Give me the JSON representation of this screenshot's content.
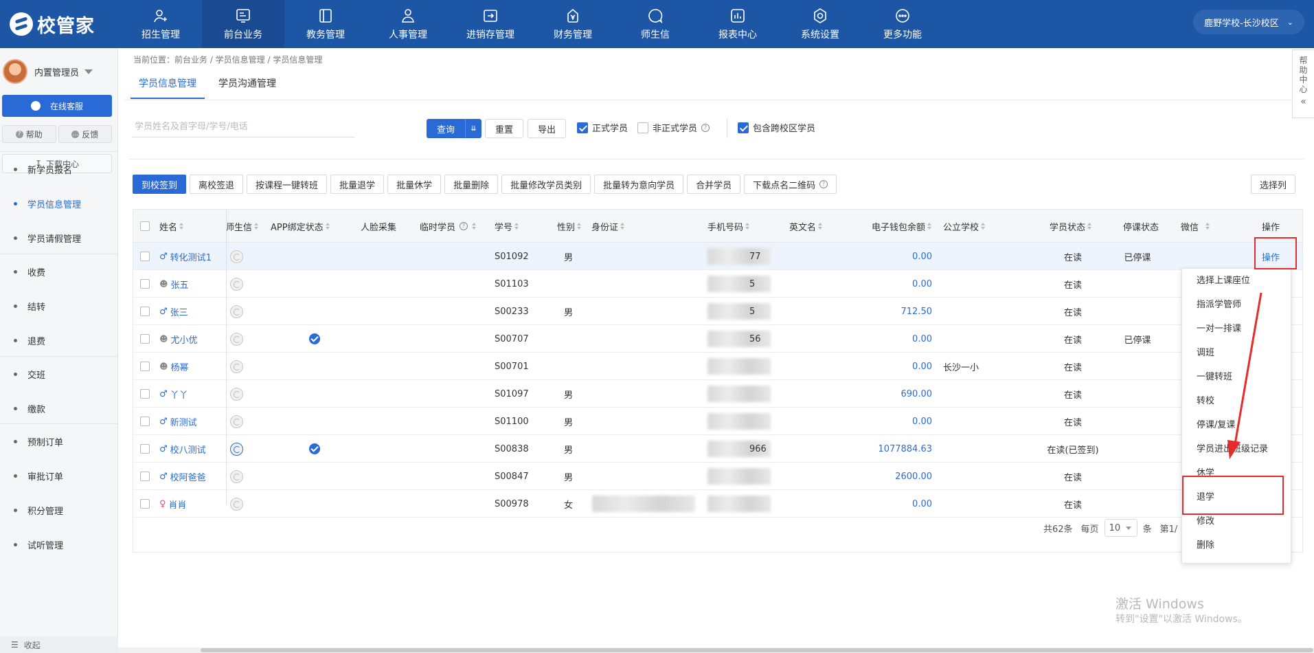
{
  "app": {
    "logo": "校管家",
    "campus": "鹿野学校-长沙校区"
  },
  "nav": [
    {
      "label": "招生管理",
      "icon": "person-plus-icon",
      "active": false
    },
    {
      "label": "前台业务",
      "icon": "monitor-icon",
      "active": true
    },
    {
      "label": "教务管理",
      "icon": "book-icon",
      "active": false
    },
    {
      "label": "人事管理",
      "icon": "person-icon",
      "active": false
    },
    {
      "label": "进销存管理",
      "icon": "inventory-icon",
      "active": false
    },
    {
      "label": "财务管理",
      "icon": "finance-icon",
      "active": false
    },
    {
      "label": "师生信",
      "icon": "chat-icon",
      "active": false
    },
    {
      "label": "报表中心",
      "icon": "report-icon",
      "active": false
    },
    {
      "label": "系统设置",
      "icon": "settings-icon",
      "active": false
    },
    {
      "label": "更多功能",
      "icon": "more-icon",
      "active": false
    }
  ],
  "sidebar": {
    "user": "内置管理员",
    "service": "在线客服",
    "help": "帮助",
    "feedback": "反馈",
    "download": "下载中心",
    "group1": [
      "新学员报名",
      "学员信息管理",
      "学员请假管理"
    ],
    "group2": [
      "收费",
      "结转",
      "退费"
    ],
    "group3": [
      "交班",
      "缴款"
    ],
    "group4": [
      "预制订单",
      "审批订单",
      "积分管理",
      "试听管理"
    ],
    "collapse": "收起"
  },
  "breadcrumb": "当前位置：前台业务 / 学员信息管理 / 学员信息管理",
  "tabs": [
    "学员信息管理",
    "学员沟通管理"
  ],
  "search": {
    "placeholder": "学员姓名及首字母/学号/电话"
  },
  "toolbar": {
    "query": "查询",
    "reset": "重置",
    "export": "导出",
    "formal": "正式学员",
    "informal": "非正式学员",
    "cross": "包含跨校区学员"
  },
  "actions": [
    "到校签到",
    "离校签退",
    "按课程一键转班",
    "批量退学",
    "批量休学",
    "批量删除",
    "批量修改学员类别",
    "批量转为意向学员",
    "合并学员",
    "下载点名二维码"
  ],
  "choose_columns": "选择列",
  "table": {
    "headers": {
      "name": "姓名",
      "wx": "师生信",
      "app": "APP绑定状态",
      "face": "人脸采集",
      "temp": "临时学员",
      "no": "学号",
      "gender": "性别",
      "id": "身份证",
      "phone": "手机号码",
      "en": "英文名",
      "wallet": "电子钱包余额",
      "school": "公立学校",
      "status": "学员状态",
      "stop": "停课状态",
      "wechat": "微信",
      "op": "操作"
    },
    "rows": [
      {
        "gender_icon": "male",
        "name": "转化测试1",
        "wx_on": false,
        "app_bound": false,
        "no": "S01092",
        "gender": "男",
        "phone_tail": "77",
        "wallet": "0.00",
        "school": "",
        "status": "在读",
        "stop": "已停课",
        "op": "操作"
      },
      {
        "gender_icon": "unknown",
        "name": "张五",
        "wx_on": false,
        "app_bound": false,
        "no": "S01103",
        "gender": "",
        "phone_tail": "5",
        "wallet": "0.00",
        "school": "",
        "status": "在读",
        "stop": "",
        "op": ""
      },
      {
        "gender_icon": "male",
        "name": "张三",
        "wx_on": false,
        "app_bound": false,
        "no": "S00233",
        "gender": "男",
        "phone_tail": "5",
        "wallet": "712.50",
        "school": "",
        "status": "在读",
        "stop": "",
        "op": ""
      },
      {
        "gender_icon": "unknown",
        "name": "尤小优",
        "wx_on": false,
        "app_bound": true,
        "no": "S00707",
        "gender": "",
        "phone_tail": "56",
        "wallet": "0.00",
        "school": "",
        "status": "在读",
        "stop": "已停课",
        "op": ""
      },
      {
        "gender_icon": "unknown",
        "name": "杨幂",
        "wx_on": false,
        "app_bound": false,
        "no": "S00701",
        "gender": "",
        "phone_tail": "",
        "wallet": "0.00",
        "school": "长沙一小",
        "status": "在读",
        "stop": "",
        "op": ""
      },
      {
        "gender_icon": "male",
        "name": "丫丫",
        "wx_on": false,
        "app_bound": false,
        "no": "S01097",
        "gender": "男",
        "phone_tail": "",
        "wallet": "690.00",
        "school": "",
        "status": "在读",
        "stop": "",
        "op": ""
      },
      {
        "gender_icon": "male",
        "name": "新测试",
        "wx_on": false,
        "app_bound": false,
        "no": "S01100",
        "gender": "男",
        "phone_tail": "",
        "wallet": "0.00",
        "school": "",
        "status": "在读",
        "stop": "",
        "op": ""
      },
      {
        "gender_icon": "male",
        "name": "校八测试",
        "wx_on": true,
        "app_bound": true,
        "no": "S00838",
        "gender": "男",
        "phone_tail": "966",
        "wallet": "1077884.63",
        "school": "",
        "status": "在读(已签到)",
        "stop": "",
        "op": ""
      },
      {
        "gender_icon": "male",
        "name": "校阿爸爸",
        "wx_on": false,
        "app_bound": false,
        "no": "S00847",
        "gender": "男",
        "phone_tail": "",
        "wallet": "2600.00",
        "school": "",
        "status": "在读",
        "stop": "",
        "op": ""
      },
      {
        "gender_icon": "female",
        "name": "肖肖",
        "wx_on": false,
        "app_bound": false,
        "no": "S00978",
        "gender": "女",
        "phone_tail": "",
        "wallet": "0.00",
        "school": "",
        "status": "在读",
        "stop": "",
        "op": ""
      }
    ]
  },
  "pager": {
    "total": "共62条",
    "per_page_label": "每页",
    "per_page": "10",
    "unit": "条",
    "page": "第1/"
  },
  "op_menu": [
    "选择上课座位",
    "指派学管师",
    "一对一排课",
    "调班",
    "一键转班",
    "转校",
    "停课/复课",
    "学员进出班级记录",
    "休学",
    "退学",
    "修改",
    "删除"
  ],
  "help_tab": [
    "帮",
    "助",
    "中",
    "心"
  ],
  "watermark": {
    "line1": "激活 Windows",
    "line2": "转到\"设置\"以激活 Windows。"
  },
  "colors": {
    "primary": "#2a6ad6",
    "topbar": "#1e56a6",
    "highlight": "#e62b2b",
    "female": "#e5497f"
  }
}
